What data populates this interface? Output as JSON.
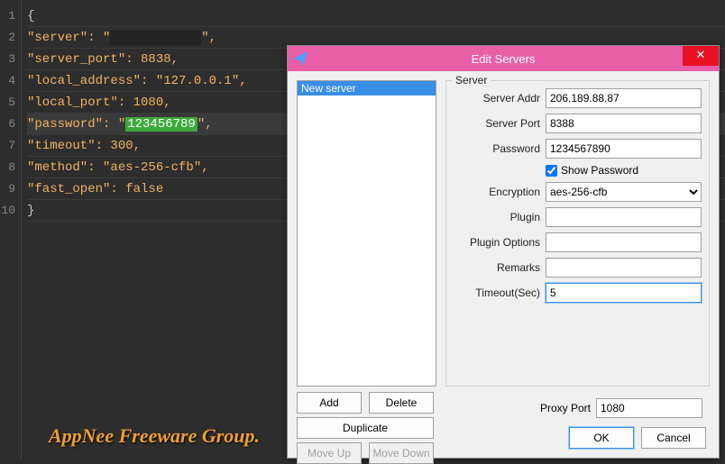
{
  "editor": {
    "lines": [
      "1",
      "2",
      "3",
      "4",
      "5",
      "6",
      "7",
      "8",
      "9",
      "10"
    ],
    "l1": "{",
    "l2_a": "\"server\": \"",
    "l2_b": "\",",
    "l3": "\"server_port\": 8838,",
    "l4": "\"local_address\": \"127.0.0.1\",",
    "l5": "\"local_port\": 1080,",
    "l6_a": "\"password\": \"",
    "l6_pwd": "123456789",
    "l6_b": "\",",
    "l7": "\"timeout\": 300,",
    "l8": "\"method\": \"aes-256-cfb\",",
    "l9": "\"fast_open\": false",
    "l10": "}"
  },
  "footer": "AppNee Freeware Group.",
  "dialog": {
    "title": "Edit Servers",
    "list": {
      "item0": "New server"
    },
    "group_legend": "Server",
    "labels": {
      "addr": "Server Addr",
      "port": "Server Port",
      "password": "Password",
      "showpw": "Show Password",
      "encryption": "Encryption",
      "plugin": "Plugin",
      "plugin_opts": "Plugin Options",
      "remarks": "Remarks",
      "timeout": "Timeout(Sec)",
      "proxy_port": "Proxy Port"
    },
    "values": {
      "addr": "206.189.88.87",
      "port": "8388",
      "password": "1234567890",
      "showpw": true,
      "encryption": "aes-256-cfb",
      "plugin": "",
      "plugin_opts": "",
      "remarks": "",
      "timeout": "5",
      "proxy_port": "1080"
    },
    "buttons": {
      "add": "Add",
      "delete": "Delete",
      "duplicate": "Duplicate",
      "moveup": "Move Up",
      "movedown": "Move Down",
      "ok": "OK",
      "cancel": "Cancel"
    }
  }
}
